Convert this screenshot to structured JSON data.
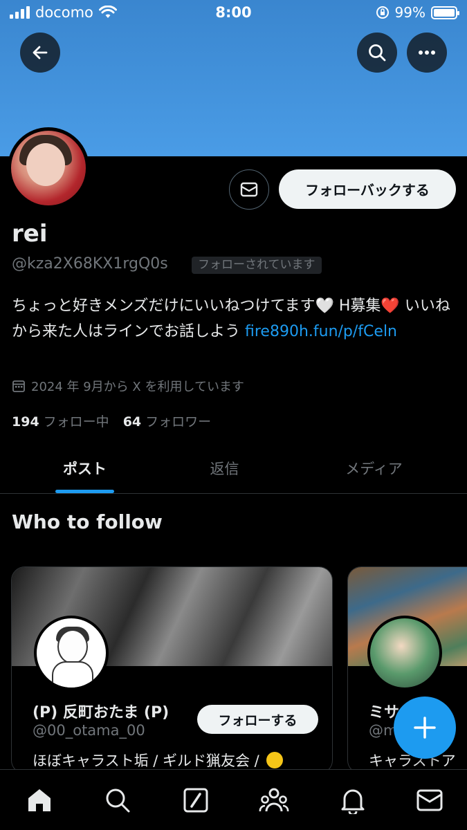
{
  "status_bar": {
    "carrier": "docomo",
    "time": "8:00",
    "battery": "99%",
    "battery_level": 0.99,
    "icons": [
      "signal-icon",
      "wifi-icon",
      "orientation-lock-icon",
      "battery-icon"
    ]
  },
  "header": {
    "back_icon": "back-arrow-icon",
    "search_icon": "search-icon",
    "more_icon": "more-icon"
  },
  "profile": {
    "name": "rei",
    "handle": "@kza2X68KX1rgQ0s",
    "follows_you_badge": "フォローされています",
    "bio_text": "ちょっと好きメンズだけにいいねつけてます",
    "bio_h_boshu": " H募集",
    "bio_text2": " いいねから来た人はラインでお話しよう ",
    "bio_link": "fire890h.fun/p/fCeln",
    "white_heart": "🤍",
    "red_heart": "❤️",
    "joined": "2024 年 9月から X を利用しています",
    "following_count": "194",
    "following_label": "フォロー中",
    "followers_count": "64",
    "followers_label": "フォロワー",
    "follow_back_button": "フォローバックする"
  },
  "tabs": [
    {
      "label": "ポスト",
      "active": true
    },
    {
      "label": "返信",
      "active": false
    },
    {
      "label": "メディア",
      "active": false
    }
  ],
  "who_to_follow": {
    "title": "Who to follow",
    "cards": [
      {
        "name": "(P) 反町おたま (P)",
        "handle": "@00_otama_00",
        "bio": "ほぼキャラスト垢 / ギルド猟友会 / ",
        "follow_button": "フォローする"
      },
      {
        "name": "ミサ",
        "handle": "@m",
        "bio": "キャラストア"
      }
    ]
  },
  "fab_icon": "plus-icon",
  "bottom_nav": [
    "home-icon",
    "search-icon",
    "grok-icon",
    "communities-icon",
    "notifications-icon",
    "messages-icon"
  ],
  "colors": {
    "accent": "#1d9bf0",
    "banner": "#4a9ce6",
    "background": "#000000",
    "secondary_text": "#71767b"
  }
}
